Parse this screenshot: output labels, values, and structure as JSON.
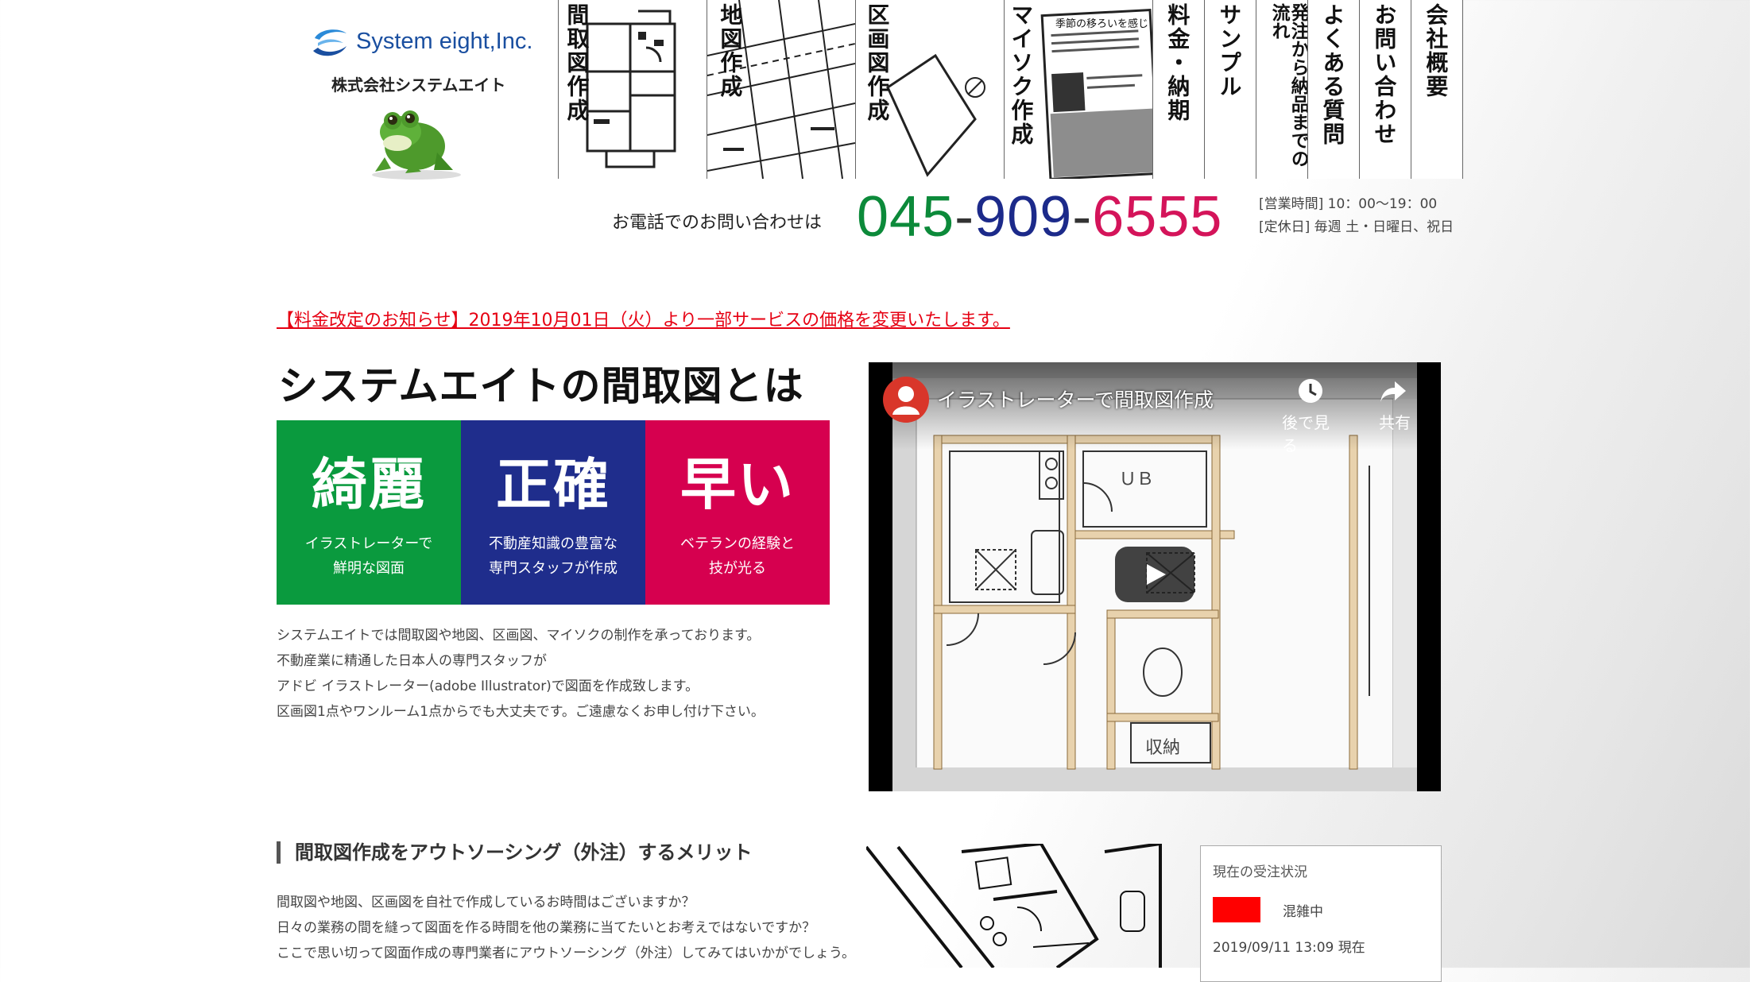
{
  "header": {
    "logo_en": "System eight,Inc.",
    "logo_ja": "株式会社システムエイト",
    "nav": [
      {
        "label": "間取図作成",
        "art": "floorplan"
      },
      {
        "label": "地図作成",
        "art": "map"
      },
      {
        "label": "区画図作成",
        "art": "lot"
      },
      {
        "label": "マイソク作成",
        "art": "flyer"
      },
      {
        "label": "料金・納期",
        "art": "none"
      },
      {
        "label": "サンプル",
        "art": "none"
      },
      {
        "label": "発注から納品までの流れ",
        "art": "none"
      },
      {
        "label": "よくある質問",
        "art": "none"
      },
      {
        "label": "お問い合わせ",
        "art": "none"
      },
      {
        "label": "会社概要",
        "art": "none"
      }
    ],
    "flyer_text": "季節の移ろいを感じ",
    "contact_label": "お電話でのお問い合わせは",
    "phone": {
      "p1": "045",
      "sep1": "-",
      "p2": "909",
      "sep2": "-",
      "p3": "6555"
    },
    "hours_line": "[営業時間] 10：00〜19：00",
    "holiday_line": "[定休日] 毎週 土・日曜日、祝日"
  },
  "notice": "【料金改定のお知らせ】2019年10月01日（火）より一部サービスの価格を変更いたします。",
  "about": {
    "heading": "システムエイトの間取図とは",
    "features": [
      {
        "title": "綺麗",
        "line1": "イラストレーターで",
        "line2": "鮮明な図面",
        "color": "#0a9a3e"
      },
      {
        "title": "正確",
        "line1": "不動産知識の豊富な",
        "line2": "専門スタッフが作成",
        "color": "#1f2d8c"
      },
      {
        "title": "早い",
        "line1": "ベテランの経験と",
        "line2": "技が光る",
        "color": "#d6004f"
      }
    ],
    "intro": [
      "システムエイトでは間取図や地図、区画図、マイソクの制作を承っております。",
      "不動産業に精通した日本人の専門スタッフが",
      "アドビ イラストレーター(adobe Illustrator)で図面を作成致します。",
      "区画図1点やワンルーム1点からでも大丈夫です。ご遠慮なくお申し付け下さい。"
    ]
  },
  "video": {
    "title": "イラストレーターで間取図作成",
    "watch_later": "後で見る",
    "share": "共有",
    "plan_labels": {
      "ub": "ＵＢ",
      "storage": "収納"
    }
  },
  "merit": {
    "heading": "間取図作成をアウトソーシング（外注）するメリット",
    "lines": [
      "間取図や地図、区画図を自社で作成しているお時間はございますか？",
      "日々の業務の間を縫って図面を作る時間を他の業務に当てたいとお考えではないですか？",
      "ここで思い切って図面作成の専門業者にアウトソーシング（外注）してみてはいかがでしょう。"
    ]
  },
  "order_status": {
    "title": "現在の受注状況",
    "state": "混雑中",
    "state_color": "#ff0000",
    "updated": "2019/09/11 13:09 現在"
  }
}
